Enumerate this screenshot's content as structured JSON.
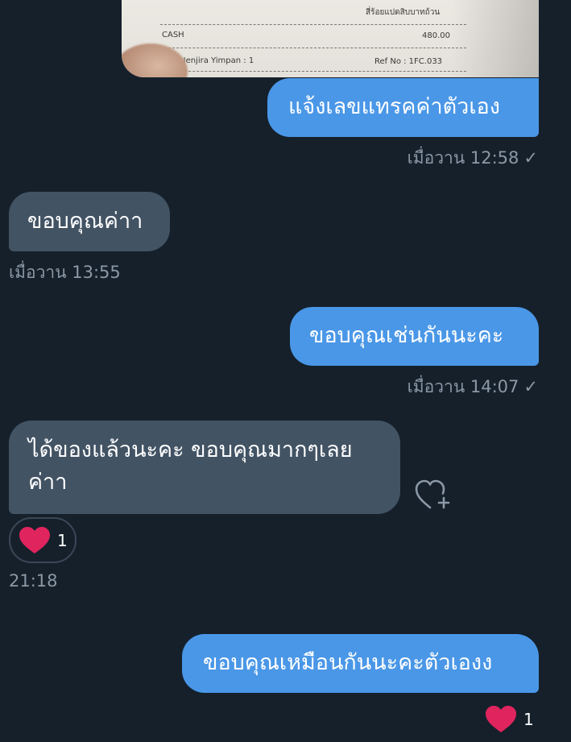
{
  "receipt": {
    "header_text": "สี่ร้อยแปดสิบบาทถ้วน",
    "payment_label": "CASH",
    "payment_amount": "480.00",
    "staff_text": "ff : Jenjira Yimpan : 1",
    "ref_text": "Ref No : 1FC.033"
  },
  "messages": [
    {
      "direction": "out",
      "text": "แจ้งเลขแทรคค่าตัวเอง",
      "time": "เมื่อวาน 12:58",
      "status": "✓"
    },
    {
      "direction": "in",
      "text": "ขอบคุณค่าา",
      "time": "เมื่อวาน 13:55"
    },
    {
      "direction": "out",
      "text": "ขอบคุณเช่นกันนะคะ",
      "time": "เมื่อวาน 14:07",
      "status": "✓"
    },
    {
      "direction": "in",
      "lines": [
        "ได้ของแล้วนะคะ ขอบคุณมากๆเลย",
        "ค่าา"
      ],
      "reaction_count": "1",
      "time": "21:18"
    },
    {
      "direction": "out",
      "text": "ขอบคุณเหมือนกันนะคะตัวเองง",
      "reaction_count": "1"
    }
  ],
  "colors": {
    "background": "#15202b",
    "outgoing_bubble": "#4a97e7",
    "incoming_bubble": "#425364",
    "timestamp": "#8b98a5",
    "heart": "#e0245e"
  }
}
